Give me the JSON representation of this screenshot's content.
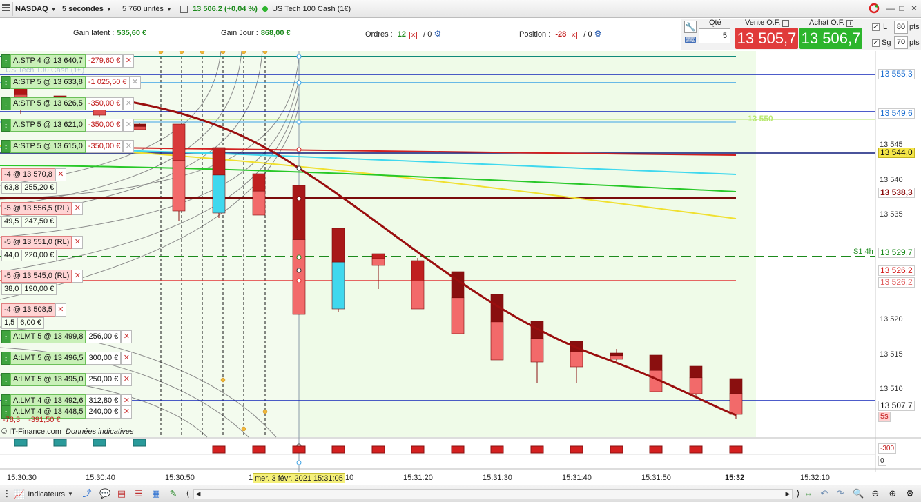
{
  "toolbar": {
    "instrument": "NASDAQ",
    "interval": "5 secondes",
    "units": "5 760 unités",
    "price": "13 506,2",
    "change": "(+0,04 %)",
    "product": "US Tech 100 Cash (1€)"
  },
  "stats": {
    "gain_latent_label": "Gain latent :",
    "gain_latent_value": "535,60 €",
    "gain_jour_label": "Gain Jour :",
    "gain_jour_value": "868,00 €",
    "ordres_label": "Ordres :",
    "ordres_count": "12",
    "ordres_other": "/ 0",
    "position_label": "Position :",
    "position_value": "-28",
    "position_other": "/ 0"
  },
  "order_panel": {
    "qty_label": "Qté",
    "qty_value": "5",
    "sell_label": "Vente O.F.",
    "sell_price": "13 505,7",
    "buy_label": "Achat O.F.",
    "buy_price": "13 506,7",
    "l_label": "L",
    "l_value": "80",
    "sg_label": "Sg",
    "sg_value": "70",
    "pts_label": "pts"
  },
  "chart": {
    "watermark": "US Tech 100 Cash (1€)",
    "copyright": "© IT-Finance.com",
    "indicative": "Données indicatives",
    "tooltip_date": "mer. 3 févr. 2021 15:31:05",
    "level_label": "13 550",
    "pivot_label": "S1 4h",
    "orders": [
      {
        "label": "A:STP 4 @ 13 640,7",
        "pnl": "-279,60 €",
        "kind": "stp",
        "x_grey": false
      },
      {
        "label": "A:STP 5 @ 13 633,8",
        "pnl": "-1 025,50 €",
        "kind": "stp",
        "x_grey": true
      },
      {
        "label": "A:STP 5 @ 13 626,5",
        "pnl": "-350,00 €",
        "kind": "stp",
        "x_grey": true
      },
      {
        "label": "A:STP 5 @ 13 621,0",
        "pnl": "-350,00 €",
        "kind": "stp",
        "x_grey": true
      },
      {
        "label": "A:STP 5 @ 13 615,0",
        "pnl": "-350,00 €",
        "kind": "stp",
        "x_grey": true
      }
    ],
    "positions": [
      {
        "label": "-4 @ 13 570,8",
        "pts": "63,8",
        "eur": "255,20 €"
      },
      {
        "label": "-5 @ 13 556,5 (RL)",
        "pts": "49,5",
        "eur": "247,50 €"
      },
      {
        "label": "-5 @ 13 551,0 (RL)",
        "pts": "44,0",
        "eur": "220,00 €"
      },
      {
        "label": "-5 @ 13 545,0 (RL)",
        "pts": "38,0",
        "eur": "190,00 €"
      },
      {
        "label": "-4 @ 13 508,5",
        "pts": "1,5",
        "eur": "6,00 €"
      }
    ],
    "limits": [
      {
        "label": "A:LMT 5 @ 13 499,8",
        "pnl": "256,00 €"
      },
      {
        "label": "A:LMT 5 @ 13 496,5",
        "pnl": "300,00 €"
      },
      {
        "label": "A:LMT 5 @ 13 495,0",
        "pnl": "250,00 €"
      },
      {
        "label": "A:LMT 4 @ 13 492,6",
        "pnl": "312,80 €"
      },
      {
        "label": "A:LMT 4 @ 13 448,5",
        "pnl": "240,00 €"
      }
    ],
    "limit_under": [
      "-78,3",
      "-391,50 €"
    ],
    "price_labels": [
      {
        "text": "13 555,3",
        "color": "#1d6fd1"
      },
      {
        "text": "13 549,6",
        "color": "#1d6fd1"
      },
      {
        "text": "13 544,0",
        "color": "#111"
      },
      {
        "text": "13 538,3",
        "color": "#8b0d0d"
      },
      {
        "text": "13 529,7",
        "color": "#1c8a1c"
      },
      {
        "text": "13 526,2",
        "color": "#d41c1c"
      },
      {
        "text": "13 526,2",
        "color": "#e06060"
      },
      {
        "text": "13 507,7",
        "color": "#111"
      },
      {
        "text": "5s",
        "color": "#c01818"
      }
    ],
    "price_ticks": [
      "13 545",
      "13 540",
      "13 535",
      "13 520",
      "13 515",
      "13 510"
    ],
    "volume_labels": [
      "-300",
      "0"
    ],
    "time_labels": [
      "15:30:30",
      "15:30:40",
      "15:30:50",
      "1",
      "10",
      "15:31:20",
      "15:31:30",
      "15:31:40",
      "15:31:50",
      "15:32",
      "15:32:10"
    ]
  },
  "bottom": {
    "indicators_label": "Indicateurs"
  }
}
